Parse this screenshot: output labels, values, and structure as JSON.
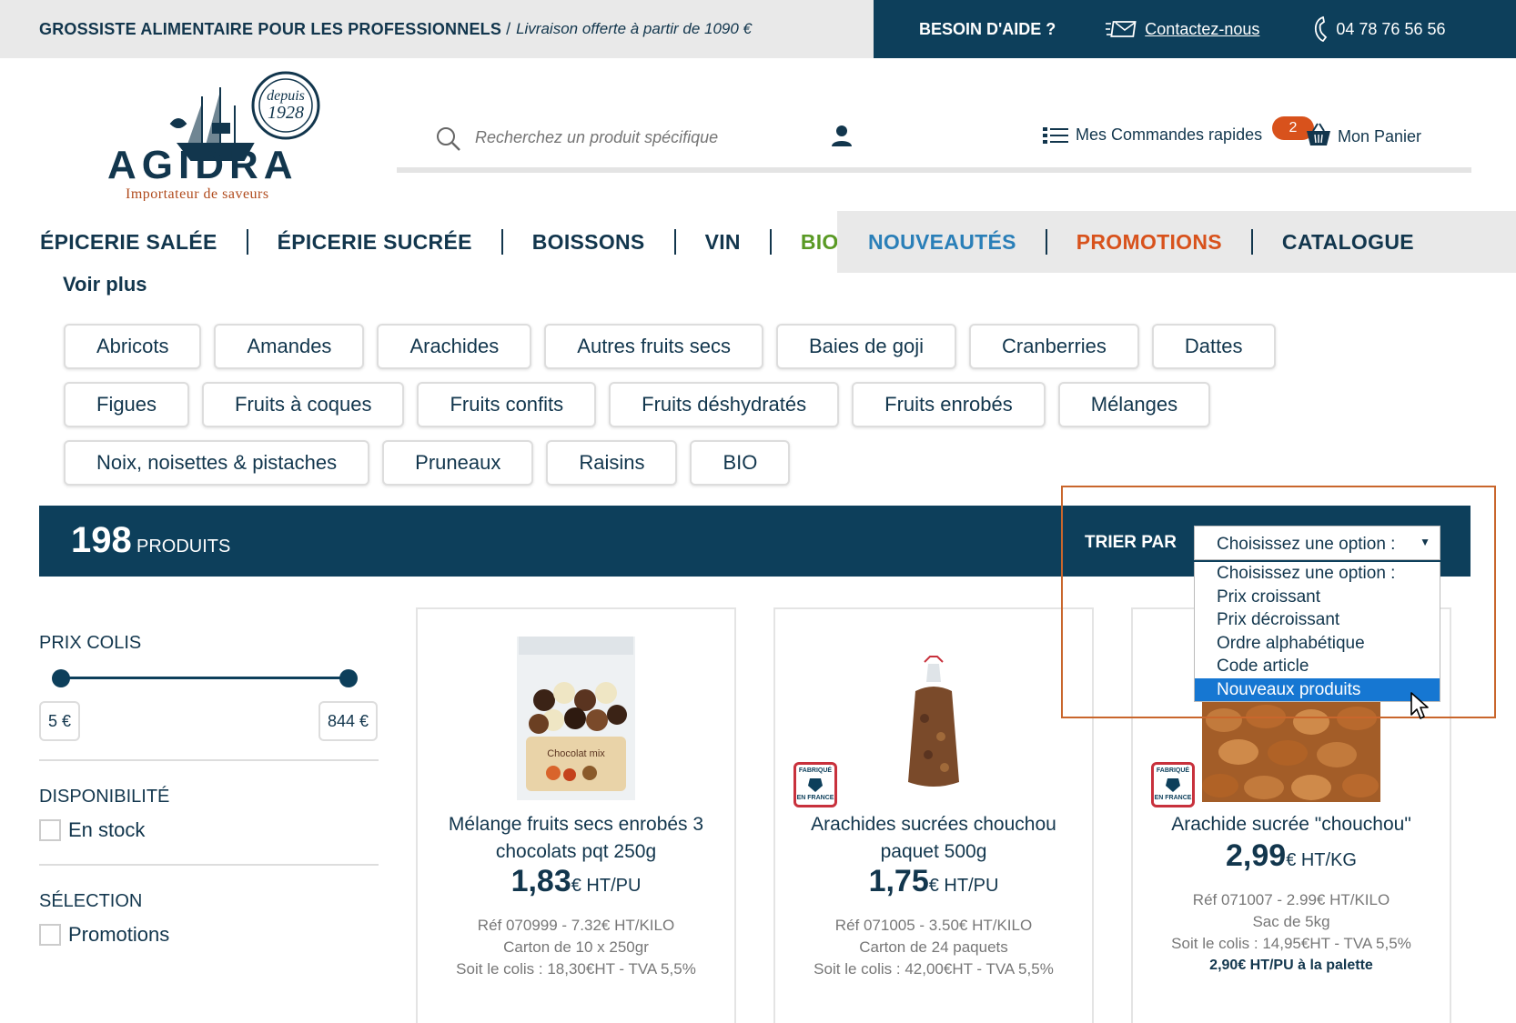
{
  "topbar": {
    "tagline": "GROSSISTE ALIMENTAIRE POUR LES PROFESSIONNELS",
    "separator": "/",
    "delivery": "Livraison offerte à partir de 1090 €",
    "help": "BESOIN D'AIDE ?",
    "contact": "Contactez-nous",
    "phone": "04 78 76 56 56"
  },
  "logo": {
    "name": "AGIDRA",
    "tagline": "Importateur de saveurs",
    "seal_line1": "depuis",
    "seal_line2": "1928"
  },
  "header": {
    "search_placeholder": "Recherchez un produit spécifique",
    "quick_orders": "Mes Commandes rapides",
    "cart_count": "2",
    "cart": "Mon Panier"
  },
  "nav": {
    "items": [
      "ÉPICERIE SALÉE",
      "ÉPICERIE SUCRÉE",
      "BOISSONS",
      "VIN",
      "BIO"
    ],
    "right_items": [
      "NOUVEAUTÉS",
      "PROMOTIONS",
      "CATALOGUE"
    ],
    "see_more": "Voir plus"
  },
  "categories": {
    "row1": [
      "Abricots",
      "Amandes",
      "Arachides",
      "Autres fruits secs",
      "Baies de goji",
      "Cranberries",
      "Dattes"
    ],
    "row2": [
      "Figues",
      "Fruits à coques",
      "Fruits confits",
      "Fruits déshydratés",
      "Fruits enrobés",
      "Mélanges"
    ],
    "row3": [
      "Noix, noisettes & pistaches",
      "Pruneaux",
      "Raisins",
      "BIO"
    ]
  },
  "results": {
    "count": "198",
    "count_label": "PRODUITS",
    "sort_label": "TRIER PAR",
    "sort_selected": "Choisissez une option :",
    "sort_options": [
      "Choisissez une option :",
      "Prix croissant",
      "Prix décroissant",
      "Ordre alphabétique",
      "Code article",
      "Nouveaux produits"
    ]
  },
  "filters": {
    "price_title": "PRIX COLIS",
    "price_min": "5 €",
    "price_max": "844 €",
    "availability_title": "DISPONIBILITÉ",
    "in_stock": "En stock",
    "selection_title": "SÉLECTION",
    "promotions": "Promotions"
  },
  "badge": {
    "line1": "FABRIQUÉ",
    "line2": "EN FRANCE"
  },
  "products": [
    {
      "title": "Mélange fruits secs enrobés 3 chocolats pqt 250g",
      "price": "1,83",
      "unit": "€ HT/PU",
      "ref": "Réf 070999 - 7.32€ HT/KILO",
      "pack": "Carton de 10 x 250gr",
      "total": "Soit le colis : 18,30€HT - TVA 5,5%",
      "pallet": "",
      "bag_label": "Chocolat mix"
    },
    {
      "title": "Arachides sucrées chouchou paquet 500g",
      "price": "1,75",
      "unit": "€ HT/PU",
      "ref": "Réf 071005 - 3.50€ HT/KILO",
      "pack": "Carton de 24 paquets",
      "total": "Soit le colis : 42,00€HT - TVA 5,5%",
      "pallet": ""
    },
    {
      "title": "Arachide sucrée \"chouchou\"",
      "price": "2,99",
      "unit": "€ HT/KG",
      "ref": "Réf 071007 - 2.99€ HT/KILO",
      "pack": "Sac de 5kg",
      "total": "Soit le colis : 14,95€HT - TVA 5,5%",
      "pallet": "2,90€ HT/PU à la palette"
    }
  ],
  "colors": {
    "navy": "#0d3f5b",
    "orange": "#d8521c",
    "green": "#5a9a25",
    "blue": "#2a7fb8",
    "select_highlight": "#1677d2"
  }
}
